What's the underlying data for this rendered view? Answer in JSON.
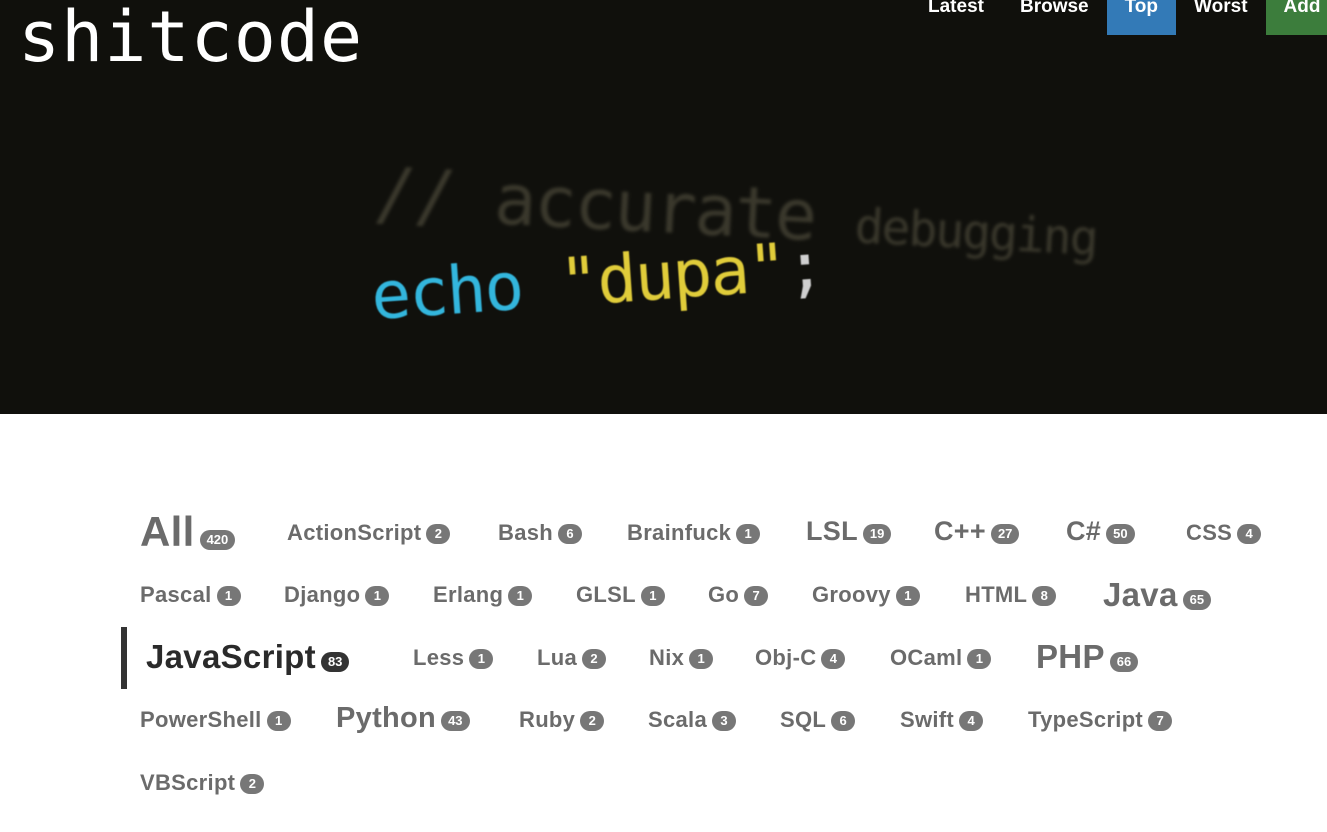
{
  "site": {
    "logo": "shitcode"
  },
  "nav": [
    {
      "label": "Latest"
    },
    {
      "label": "Browse"
    },
    {
      "label": "Top"
    },
    {
      "label": "Worst"
    },
    {
      "label": "Add"
    }
  ],
  "hero": {
    "comment_slashes": "//",
    "comment_word1": "accurate",
    "comment_word2": "debugging",
    "keyword": "echo",
    "string": "\"dupa\"",
    "terminator": ";"
  },
  "tags": [
    {
      "label": "All",
      "count": "420"
    },
    {
      "label": "ActionScript",
      "count": "2"
    },
    {
      "label": "Bash",
      "count": "6"
    },
    {
      "label": "Brainfuck",
      "count": "1"
    },
    {
      "label": "LSL",
      "count": "19"
    },
    {
      "label": "C++",
      "count": "27"
    },
    {
      "label": "C#",
      "count": "50"
    },
    {
      "label": "CSS",
      "count": "4"
    },
    {
      "label": "Pascal",
      "count": "1"
    },
    {
      "label": "Django",
      "count": "1"
    },
    {
      "label": "Erlang",
      "count": "1"
    },
    {
      "label": "GLSL",
      "count": "1"
    },
    {
      "label": "Go",
      "count": "7"
    },
    {
      "label": "Groovy",
      "count": "1"
    },
    {
      "label": "HTML",
      "count": "8"
    },
    {
      "label": "Java",
      "count": "65"
    },
    {
      "label": "JavaScript",
      "count": "83"
    },
    {
      "label": "Less",
      "count": "1"
    },
    {
      "label": "Lua",
      "count": "2"
    },
    {
      "label": "Nix",
      "count": "1"
    },
    {
      "label": "Obj-C",
      "count": "4"
    },
    {
      "label": "OCaml",
      "count": "1"
    },
    {
      "label": "PHP",
      "count": "66"
    },
    {
      "label": "PowerShell",
      "count": "1"
    },
    {
      "label": "Python",
      "count": "43"
    },
    {
      "label": "Ruby",
      "count": "2"
    },
    {
      "label": "Scala",
      "count": "3"
    },
    {
      "label": "SQL",
      "count": "6"
    },
    {
      "label": "Swift",
      "count": "4"
    },
    {
      "label": "TypeScript",
      "count": "7"
    },
    {
      "label": "VBScript",
      "count": "2"
    }
  ],
  "colors": {
    "nav_active": "#337ab7",
    "nav_add": "#3c7d3c",
    "badge": "#777777",
    "hero_bg": "#10100c"
  }
}
